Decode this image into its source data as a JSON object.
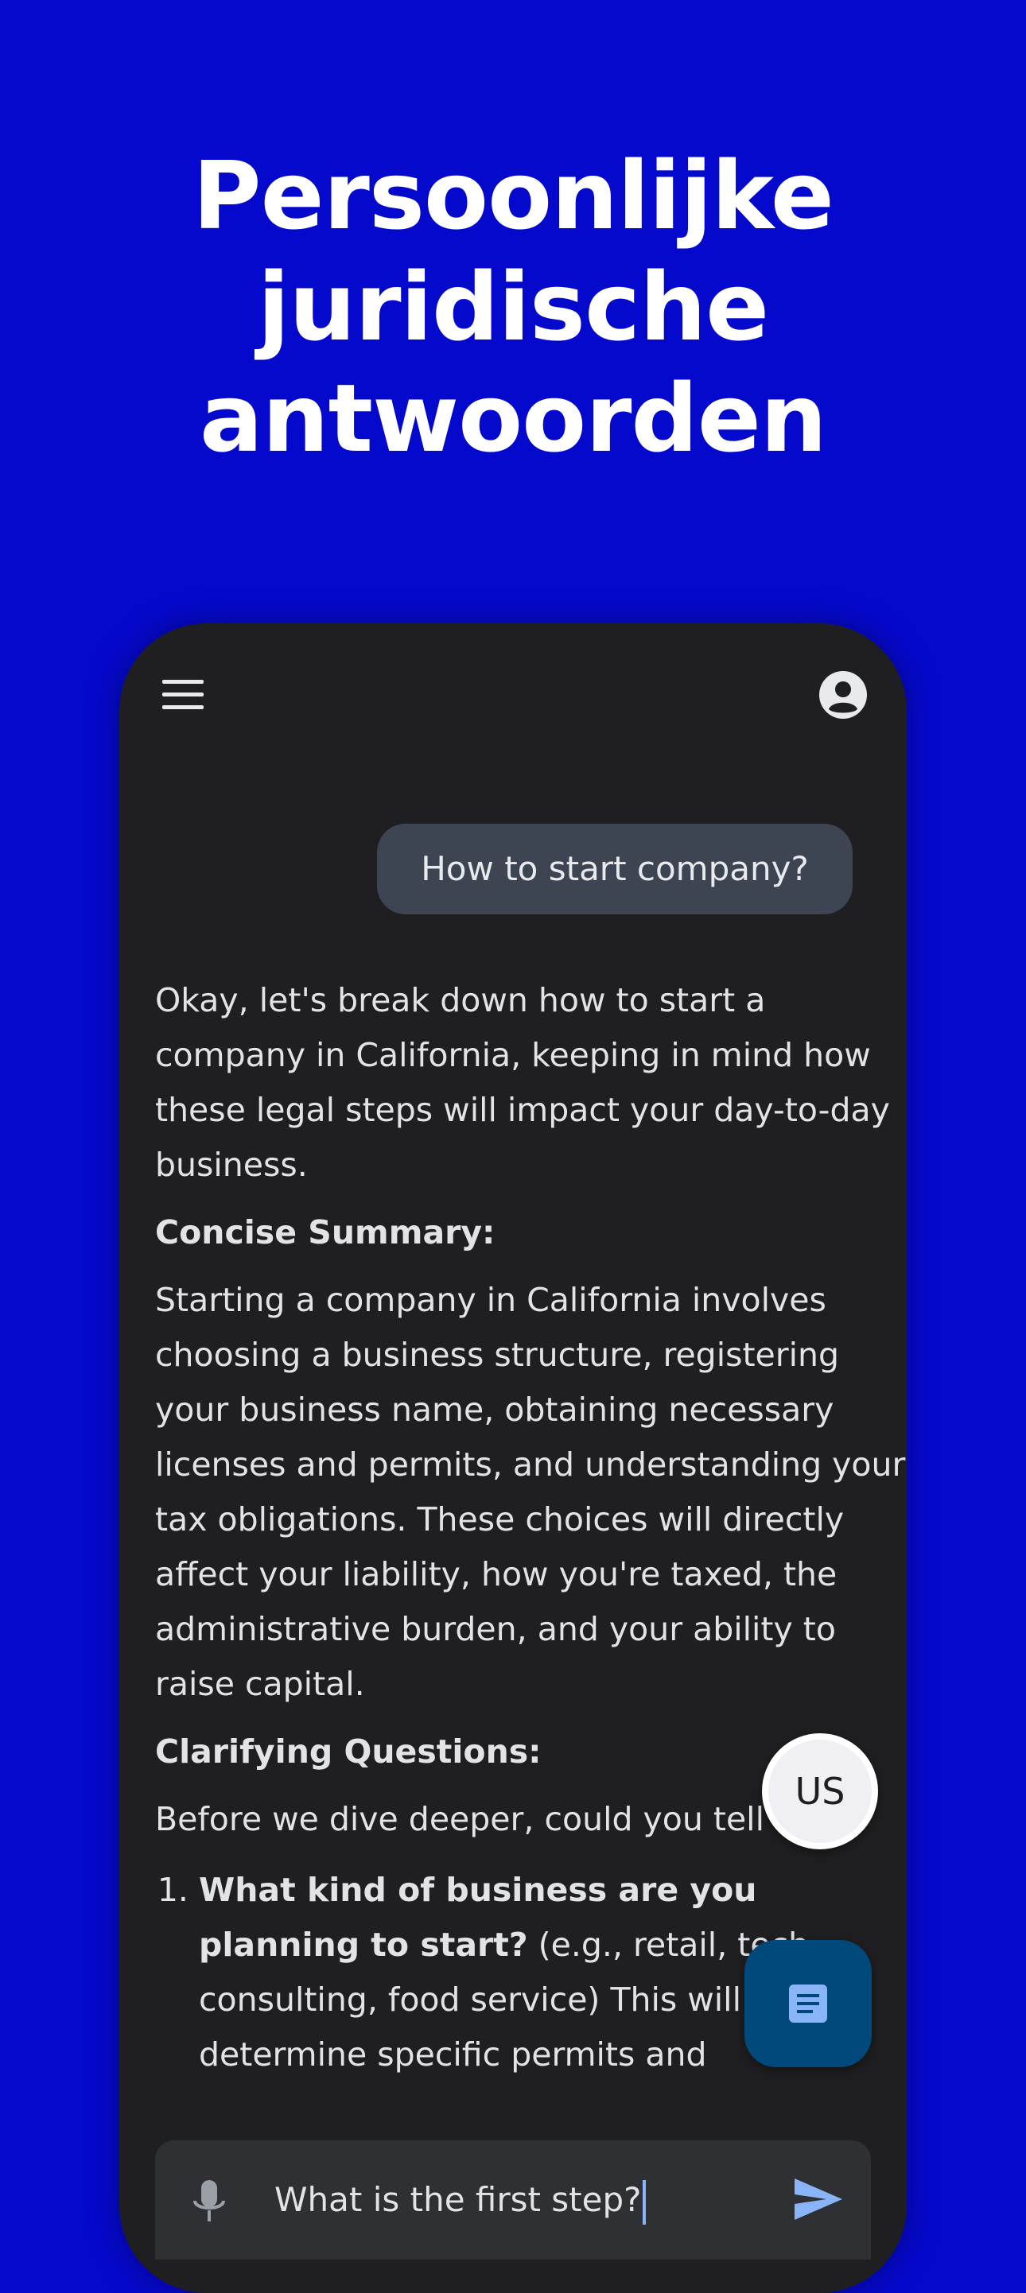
{
  "headline": {
    "line1": "Persoonlijke",
    "line2": "juridische",
    "line3": "antwoorden"
  },
  "colors": {
    "background": "#0509cc",
    "phone_surface": "#1f1f21",
    "user_bubble": "#3d4552",
    "doc_fab": "#00497a",
    "accent": "#8ab4f8"
  },
  "toolbar": {
    "menu_icon": "hamburger-menu-icon",
    "account_icon": "account-circle-icon"
  },
  "chat": {
    "user_message": "How to start company?",
    "intro": "Okay, let's break down how to start a company in California, keeping in mind how these legal steps will impact your day-to-day business.",
    "summary_heading": "Concise Summary:",
    "summary_text": "Starting a company in California involves choosing a business structure, registering your business name, obtaining necessary licenses and permits, and understanding your tax obligations. These choices will directly affect your liability, how you're taxed, the administrative burden, and your ability to raise capital.",
    "questions_heading": "Clarifying Questions:",
    "questions_intro": "Before we dive deeper, could you tell me:",
    "questions": [
      {
        "bold": "What kind of business are you planning to start?",
        "text": " (e.g., retail, tech, consulting, food service) This will help determine specific permits and"
      }
    ]
  },
  "fab": {
    "jurisdiction_label": "US",
    "document_icon": "document-icon"
  },
  "input": {
    "value": "What is the first step?",
    "mic_icon": "microphone-icon",
    "send_icon": "send-icon"
  }
}
